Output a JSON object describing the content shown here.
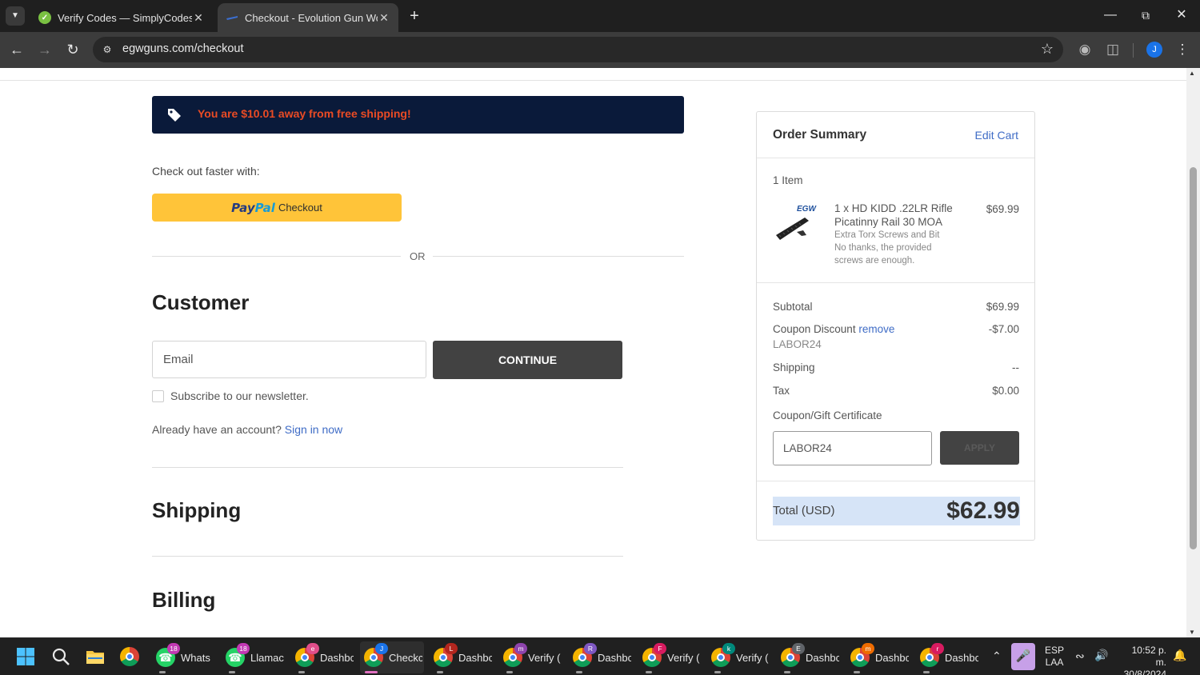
{
  "browser": {
    "tabs": [
      {
        "title": "Verify Codes — SimplyCodes",
        "active": false
      },
      {
        "title": "Checkout - Evolution Gun Works",
        "active": true
      }
    ],
    "url": "egwguns.com/checkout",
    "profile_initial": "J"
  },
  "banner": {
    "text": "You are $10.01 away from free shipping!"
  },
  "checkout": {
    "faster_label": "Check out faster with:",
    "paypal": {
      "pay": "Pay",
      "pal": "Pal",
      "checkout": "Checkout"
    },
    "or": "OR",
    "customer_heading": "Customer",
    "email_placeholder": "Email",
    "continue_label": "CONTINUE",
    "newsletter_label": "Subscribe to our newsletter.",
    "already_account": "Already have an account?",
    "sign_in": "Sign in now",
    "shipping_heading": "Shipping",
    "billing_heading": "Billing"
  },
  "summary": {
    "title": "Order Summary",
    "edit_cart": "Edit Cart",
    "item_count": "1 Item",
    "item": {
      "brand": "EGW",
      "name": "1 x HD KIDD .22LR Rifle Picatinny Rail 30 MOA",
      "option_1": "Extra Torx Screws and Bit",
      "option_2": "No thanks, the provided screws are enough.",
      "price": "$69.99"
    },
    "subtotal_label": "Subtotal",
    "subtotal": "$69.99",
    "coupon_label": "Coupon Discount",
    "coupon_remove": "remove",
    "coupon_code": "LABOR24",
    "coupon_value": "-$7.00",
    "shipping_label": "Shipping",
    "shipping_value": "--",
    "tax_label": "Tax",
    "tax_value": "$0.00",
    "gift_label": "Coupon/Gift Certificate",
    "gift_input_value": "LABOR24",
    "apply_label": "APPLY",
    "total_label": "Total (USD)",
    "total_value": "$62.99"
  },
  "taskbar": {
    "apps": [
      {
        "label": "Whats",
        "badge": "18",
        "badge_color": "#c239b3",
        "kind": "whatsapp"
      },
      {
        "label": "Llamac",
        "badge": "18",
        "badge_color": "#c239b3",
        "kind": "whatsapp"
      },
      {
        "label": "Dashbc",
        "badge": "e",
        "badge_color": "#e04e8a",
        "kind": "chrome"
      },
      {
        "label": "Checkc",
        "badge": "J",
        "badge_color": "#1a73e8",
        "kind": "chrome",
        "active": true
      },
      {
        "label": "Dashbc",
        "badge": "L",
        "badge_color": "#b3261e",
        "kind": "chrome"
      },
      {
        "label": "Verify (",
        "badge": "m",
        "badge_color": "#8e44ad",
        "kind": "chrome"
      },
      {
        "label": "Dashbc",
        "badge": "R",
        "badge_color": "#7e57c2",
        "kind": "chrome"
      },
      {
        "label": "Verify (",
        "badge": "F",
        "badge_color": "#d81b60",
        "kind": "chrome"
      },
      {
        "label": "Verify (",
        "badge": "k",
        "badge_color": "#00897b",
        "kind": "chrome"
      },
      {
        "label": "Dashbc",
        "badge": "E",
        "badge_color": "#5f6368",
        "kind": "chrome"
      },
      {
        "label": "Dashbc",
        "badge": "m",
        "badge_color": "#ef6c00",
        "kind": "chrome"
      },
      {
        "label": "Dashbc",
        "badge": "r",
        "badge_color": "#d81b60",
        "kind": "chrome"
      }
    ],
    "lang_1": "ESP",
    "lang_2": "LAA",
    "time": "10:52 p. m.",
    "date": "30/8/2024"
  }
}
